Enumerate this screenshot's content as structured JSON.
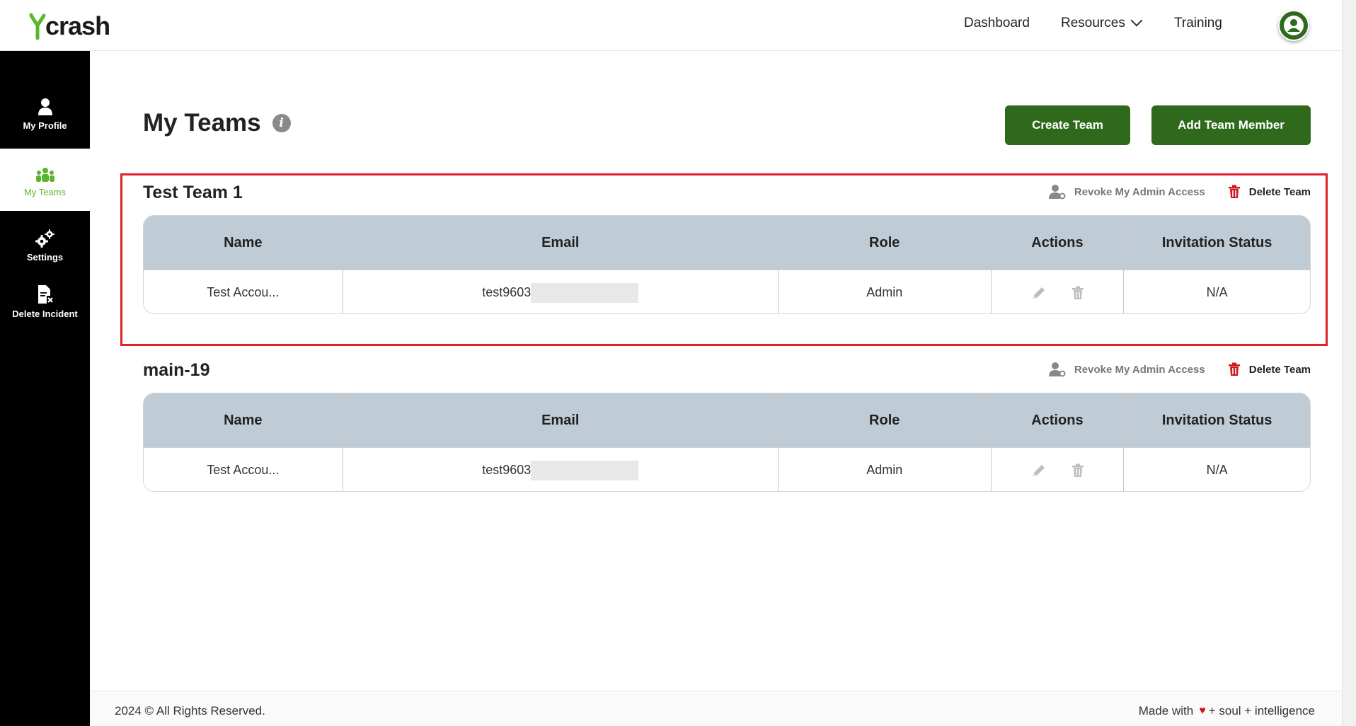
{
  "brand": {
    "logo_text": "crash",
    "accent": "#5bb531",
    "primary_button": "#2f6a1c",
    "highlight": "#e0202a"
  },
  "nav": {
    "dashboard": "Dashboard",
    "resources": "Resources",
    "training": "Training"
  },
  "sidebar": {
    "items": [
      {
        "label": "My Profile",
        "icon": "user-icon",
        "active": false
      },
      {
        "label": "My Teams",
        "icon": "team-icon",
        "active": true
      },
      {
        "label": "Settings",
        "icon": "gears-icon",
        "active": false
      },
      {
        "label": "Delete Incident",
        "icon": "file-delete-icon",
        "active": false
      }
    ]
  },
  "page": {
    "title": "My Teams",
    "create_team": "Create Team",
    "add_team_member": "Add Team Member"
  },
  "table_headers": [
    "Name",
    "Email",
    "Role",
    "Actions",
    "Invitation Status"
  ],
  "teams": [
    {
      "name": "Test Team 1",
      "revoke_label": "Revoke My Admin Access",
      "delete_label": "Delete Team",
      "rows": [
        {
          "name": "Test Accou...",
          "email": "test9603",
          "role": "Admin",
          "status": "N/A"
        }
      ]
    },
    {
      "name": "main-19",
      "revoke_label": "Revoke My Admin Access",
      "delete_label": "Delete Team",
      "rows": [
        {
          "name": "Test Accou...",
          "email": "test9603",
          "role": "Admin",
          "status": "N/A"
        }
      ]
    }
  ],
  "footer": {
    "copyright": "2024 © All Rights Reserved.",
    "made_with": "Made with",
    "made_tail": "+ soul + intelligence"
  }
}
